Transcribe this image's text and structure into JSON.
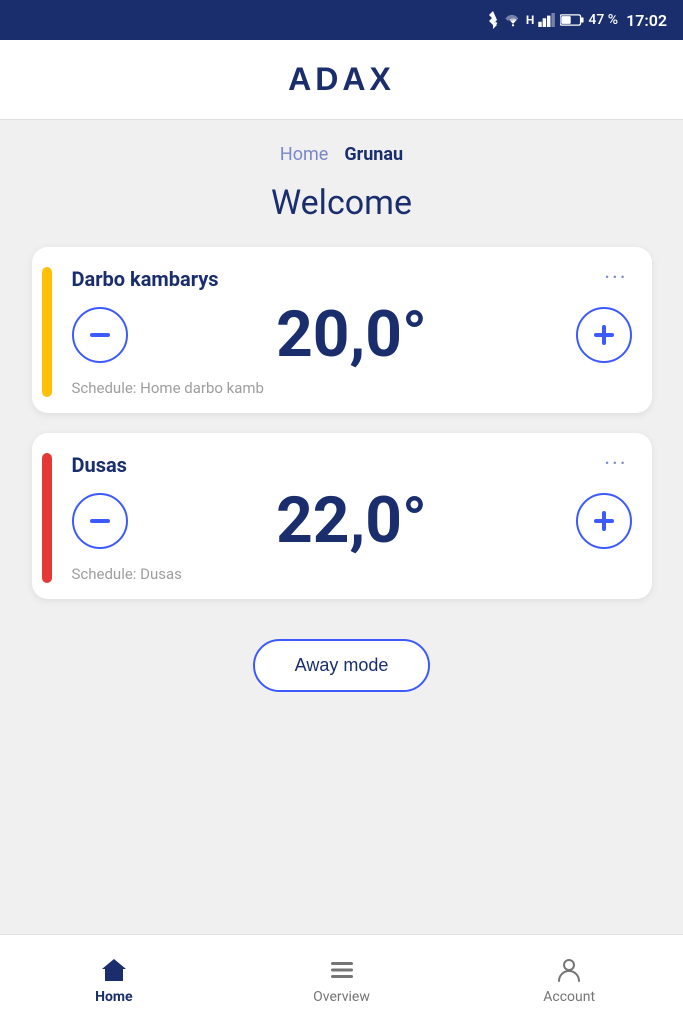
{
  "statusBar": {
    "battery": "47 %",
    "time": "17:02"
  },
  "header": {
    "logo": "ADAX"
  },
  "breadcrumb": {
    "parent": "Home",
    "current": "Grunau"
  },
  "welcome": {
    "title": "Welcome"
  },
  "devices": [
    {
      "id": "device-1",
      "name": "Darbo kambarys",
      "temperature": "20,0°",
      "schedule": "Schedule: Home darbo kamb",
      "accentColor": "yellow",
      "moreLabel": "···"
    },
    {
      "id": "device-2",
      "name": "Dusas",
      "temperature": "22,0°",
      "schedule": "Schedule: Dusas",
      "accentColor": "orange",
      "moreLabel": "···"
    }
  ],
  "awayMode": {
    "label": "Away mode"
  },
  "bottomNav": {
    "items": [
      {
        "id": "home",
        "label": "Home",
        "active": true
      },
      {
        "id": "overview",
        "label": "Overview",
        "active": false
      },
      {
        "id": "account",
        "label": "Account",
        "active": false
      }
    ]
  }
}
